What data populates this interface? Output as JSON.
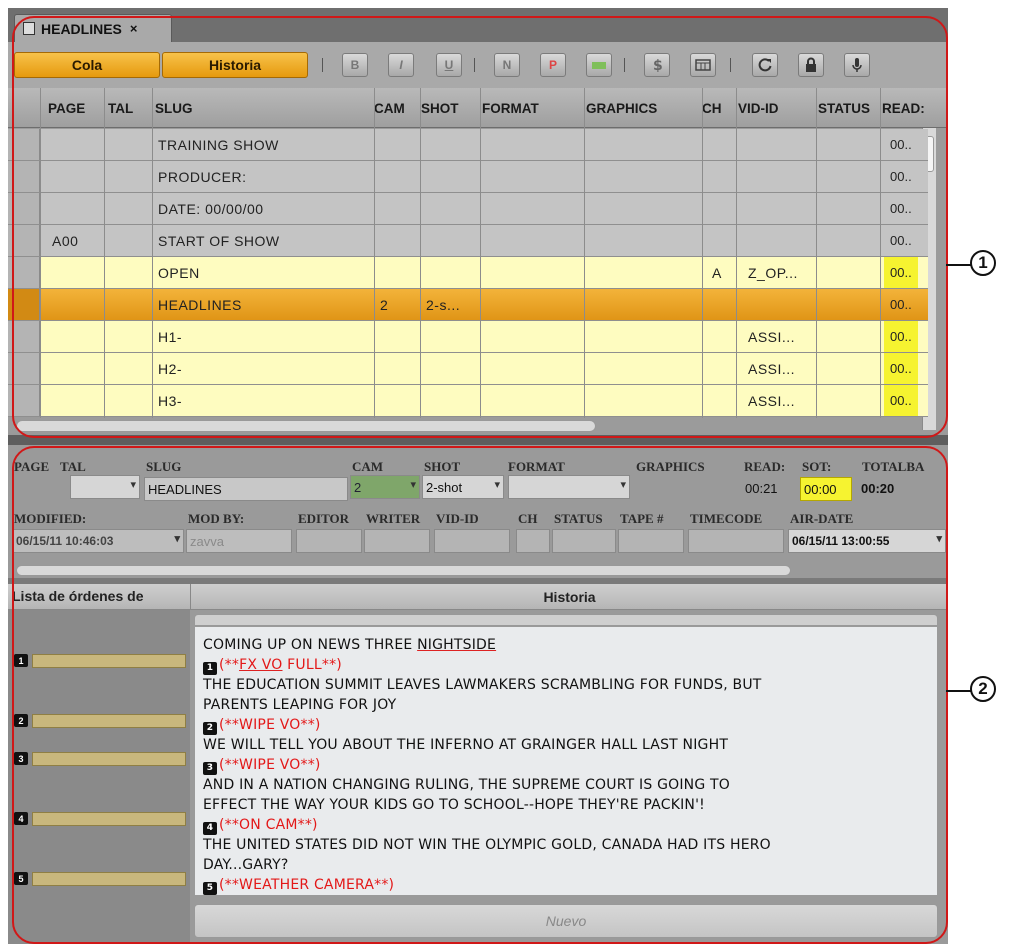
{
  "tab": {
    "title": "HEADLINES",
    "close": "×"
  },
  "toolbar": {
    "cola": "Cola",
    "historia": "Historia",
    "bold": "B",
    "italic": "I",
    "underline": "U",
    "n": "N",
    "p": "P",
    "sep": "|"
  },
  "grid": {
    "columns": [
      "PAGE",
      "TAL",
      "SLUG",
      "CAM",
      "SHOT",
      "FORMAT",
      "GRAPHICS",
      "CH",
      "VID-ID",
      "STATUS",
      "READ:"
    ],
    "rows": [
      {
        "page": "",
        "slug": "TRAINING SHOW",
        "cam": "",
        "shot": "",
        "ch": "",
        "vid": "",
        "read": "00..",
        "style": "gray"
      },
      {
        "page": "",
        "slug": "PRODUCER:",
        "cam": "",
        "shot": "",
        "ch": "",
        "vid": "",
        "read": "00..",
        "style": "gray"
      },
      {
        "page": "",
        "slug": "DATE: 00/00/00",
        "cam": "",
        "shot": "",
        "ch": "",
        "vid": "",
        "read": "00..",
        "style": "gray"
      },
      {
        "page": "A00",
        "slug": "START OF SHOW",
        "cam": "",
        "shot": "",
        "ch": "",
        "vid": "",
        "read": "00..",
        "style": "gray"
      },
      {
        "page": "",
        "slug": "OPEN",
        "cam": "",
        "shot": "",
        "ch": "A",
        "vid": "Z_OP...",
        "read": "00..",
        "style": "yellow"
      },
      {
        "page": "",
        "slug": "HEADLINES",
        "cam": "2",
        "shot": "2-s...",
        "ch": "",
        "vid": "",
        "read": "00..",
        "style": "sel"
      },
      {
        "page": "",
        "slug": "H1-",
        "cam": "",
        "shot": "",
        "ch": "",
        "vid": "ASSI...",
        "read": "00..",
        "style": "yellow"
      },
      {
        "page": "",
        "slug": "H2-",
        "cam": "",
        "shot": "",
        "ch": "",
        "vid": "ASSI...",
        "read": "00..",
        "style": "yellow"
      },
      {
        "page": "",
        "slug": "H3-",
        "cam": "",
        "shot": "",
        "ch": "",
        "vid": "ASSI...",
        "read": "00..",
        "style": "yellow"
      }
    ]
  },
  "details": {
    "labels": {
      "page": "PAGE",
      "tal": "TAL",
      "slug": "SLUG",
      "cam": "CAM",
      "shot": "SHOT",
      "format": "FORMAT",
      "graphics": "GRAPHICS",
      "read": "READ:",
      "sot": "SOT:",
      "total": "TOTALBA",
      "modified": "MODIFIED:",
      "modby": "MOD BY:",
      "editor": "EDITOR",
      "writer": "WRITER",
      "vidid": "VID-ID",
      "ch": "CH",
      "status": "STATUS",
      "tape": "TAPE #",
      "timecode": "TIMECODE",
      "airdate": "AIR-DATE"
    },
    "values": {
      "slug": "HEADLINES",
      "cam": "2",
      "shot": "2-shot",
      "read": "00:21",
      "sot": "00:00",
      "total": "00:20",
      "modified": "06/15/11 10:46:03",
      "modby": "zavva",
      "airdate": "06/15/11 13:00:55"
    }
  },
  "lower": {
    "left_header": "Lista de órdenes de",
    "right_header": "Historia",
    "cue_numbers": [
      "1",
      "2",
      "3",
      "4",
      "5"
    ],
    "nuevo": "Nuevo",
    "story": {
      "l1a": "COMING UP ON NEWS THREE ",
      "l1b": "NIGHTSIDE",
      "c1a": "(**",
      "c1b": "FX VO",
      "c1c": " FULL**)",
      "l2": "THE EDUCATION SUMMIT LEAVES LAWMAKERS SCRAMBLING FOR FUNDS, BUT",
      "l3": "PARENTS LEAPING FOR JOY",
      "c2": "(**WIPE VO**)",
      "l4": "WE WILL TELL YOU ABOUT THE INFERNO AT GRAINGER HALL LAST NIGHT",
      "c3": "(**WIPE VO**)",
      "l5": "AND IN A NATION CHANGING RULING, THE SUPREME COURT IS GOING TO",
      "l6": "EFFECT THE WAY YOUR KIDS GO TO SCHOOL--HOPE THEY'RE PACKIN'!",
      "c4": "(**ON CAM**)",
      "l7": "THE UNITED STATES DID NOT WIN THE OLYMPIC GOLD, CANADA HAD ITS HERO",
      "l8": "DAY...GARY?",
      "c5": "(**WEATHER CAMERA**)"
    }
  },
  "annotations": {
    "one": "1",
    "two": "2"
  },
  "colors": {
    "accent": "#e69a0e",
    "highlight": "#f6f330",
    "cue": "#e31818",
    "annotation": "#d01818"
  }
}
